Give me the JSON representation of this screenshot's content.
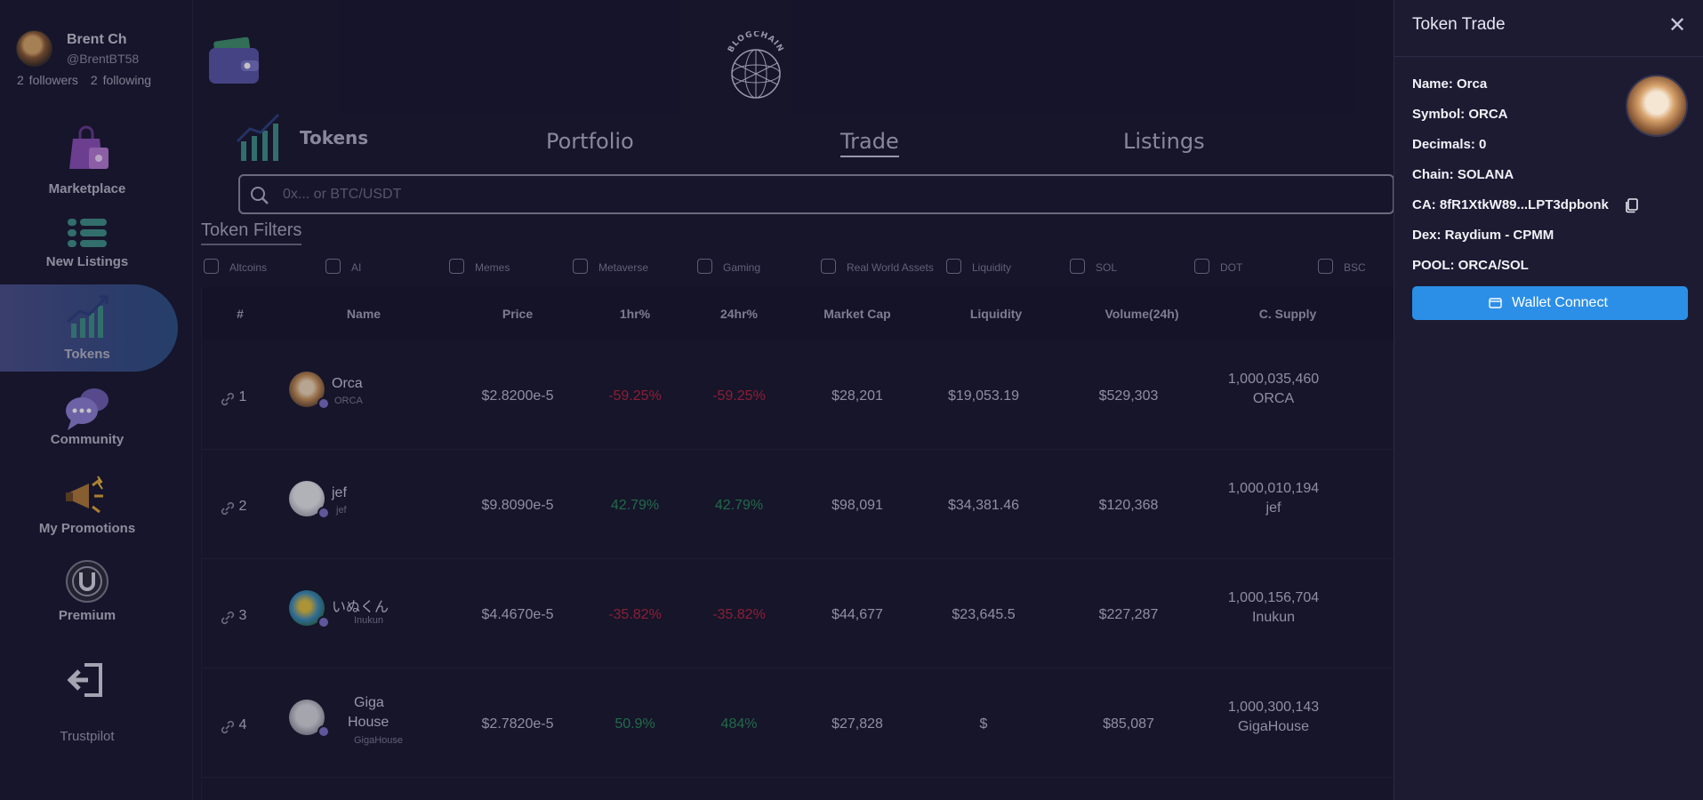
{
  "profile": {
    "name": "Brent Ch",
    "handle": "@BrentBT58",
    "followers": "2 followers",
    "following": "2 following"
  },
  "sidebar": {
    "items": [
      {
        "label": "Marketplace",
        "icon": "shopping-bag-icon"
      },
      {
        "label": "New Listings",
        "icon": "list-icon"
      },
      {
        "label": "Tokens",
        "icon": "chart-icon",
        "active": true
      },
      {
        "label": "Community",
        "icon": "chat-bubbles-icon"
      },
      {
        "label": "My Promotions",
        "icon": "megaphone-icon"
      },
      {
        "label": "Premium",
        "icon": "premium-badge-icon"
      },
      {
        "label": "Trustpilot",
        "icon": "logout-icon"
      }
    ]
  },
  "header": {
    "logo_text": "BLOGCHAIN"
  },
  "tabs": [
    {
      "label": "Tokens"
    },
    {
      "label": "Portfolio"
    },
    {
      "label": "Trade",
      "active": true
    },
    {
      "label": "Listings"
    }
  ],
  "search": {
    "placeholder": "0x... or BTC/USDT",
    "value": ""
  },
  "filters": {
    "title": "Token Filters",
    "options": [
      "Altcoins",
      "AI",
      "Memes",
      "Metaverse",
      "Gaming",
      "Real World Assets",
      "Liquidity",
      "SOL",
      "DOT",
      "BSC"
    ]
  },
  "table": {
    "headers": [
      "#",
      "Name",
      "Price",
      "1hr%",
      "24hr%",
      "Market Cap",
      "Liquidity",
      "Volume(24h)",
      "C. Supply"
    ],
    "rows": [
      {
        "rank": "1",
        "name": "Orca",
        "symbol": "ORCA",
        "price": "$2.8200e-5",
        "h1": "-59.25%",
        "h24": "-59.25%",
        "mcap": "$28,201",
        "liquidity": "$19,053.19",
        "volume": "$529,303",
        "supply": "1,000,035,460",
        "supply_unit": "ORCA",
        "trend": "neg"
      },
      {
        "rank": "2",
        "name": "jef",
        "symbol": "jef",
        "price": "$9.8090e-5",
        "h1": "42.79%",
        "h24": "42.79%",
        "mcap": "$98,091",
        "liquidity": "$34,381.46",
        "volume": "$120,368",
        "supply": "1,000,010,194",
        "supply_unit": "jef",
        "trend": "pos"
      },
      {
        "rank": "3",
        "name": "いぬくん",
        "symbol": "Inukun",
        "price": "$4.4670e-5",
        "h1": "-35.82%",
        "h24": "-35.82%",
        "mcap": "$44,677",
        "liquidity": "$23,645.5",
        "volume": "$227,287",
        "supply": "1,000,156,704",
        "supply_unit": "Inukun",
        "trend": "neg"
      },
      {
        "rank": "4",
        "name_line1": "Giga",
        "name_line2": "House",
        "symbol": "GigaHouse",
        "price": "$2.7820e-5",
        "h1": "50.9%",
        "h24": "484%",
        "mcap": "$27,828",
        "liquidity": "$",
        "volume": "$85,087",
        "supply": "1,000,300,143",
        "supply_unit": "GigaHouse",
        "trend": "pos"
      }
    ]
  },
  "panel": {
    "title": "Token Trade",
    "name": "Name: Orca",
    "symbol": "Symbol: ORCA",
    "decimals": "Decimals: 0",
    "chain": "Chain: SOLANA",
    "ca": "CA: 8fR1XtkW89...LPT3dpbonk",
    "dex": "Dex: Raydium - CPMM",
    "pool": "POOL: ORCA/SOL",
    "wallet_button": "Wallet Connect"
  },
  "colors": {
    "background": "#1a1830",
    "accent": "#2b8fe8",
    "negative": "#b6253f",
    "positive": "#2a8a5a"
  }
}
